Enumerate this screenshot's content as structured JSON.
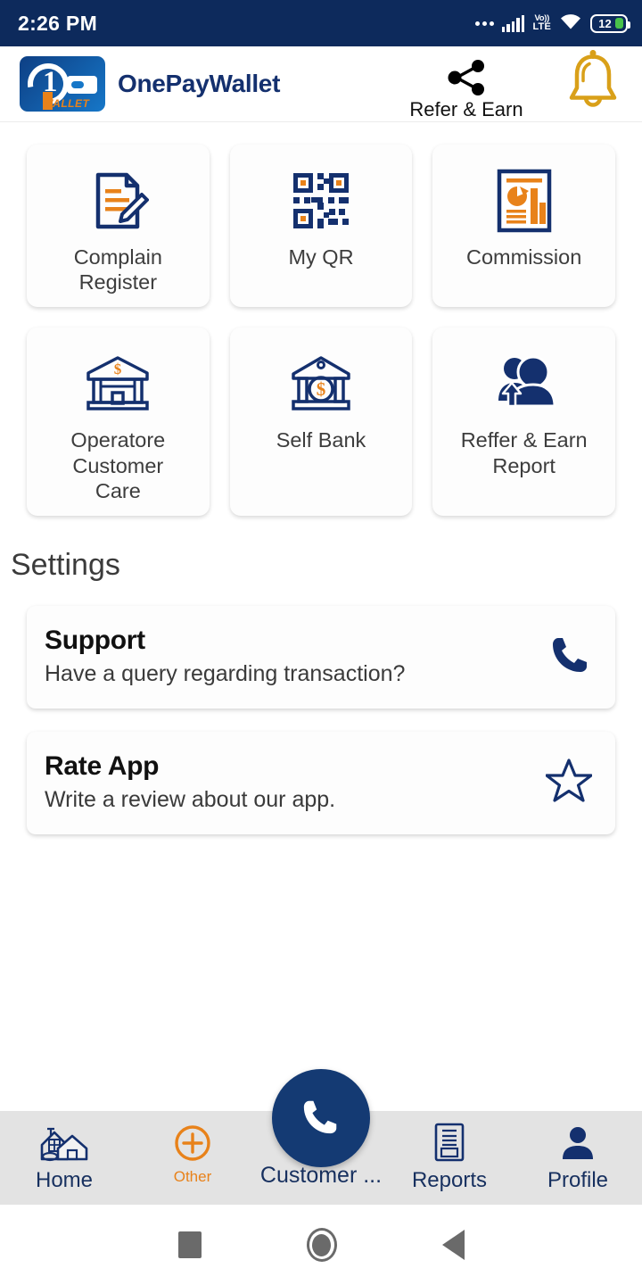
{
  "status_bar": {
    "time": "2:26 PM",
    "network_type": "VoLTE",
    "volte_top": "Vo))",
    "volte_bottom": "LTE",
    "battery_level": "12",
    "background_color": "#0d2a5c"
  },
  "app_bar": {
    "brand_name": "OnePayWallet",
    "logo_digit": "1",
    "logo_wordmark": "WALLET",
    "refer_label": "Refer & Earn",
    "share_icon": "share-icon",
    "bell_icon": "bell-icon",
    "bell_color": "#d9a019",
    "brand_color": "#14306e"
  },
  "grid": {
    "tiles": [
      {
        "label": "Complain\nRegister",
        "label_line1": "Complain",
        "label_line2": "Register",
        "icon": "document-edit-icon"
      },
      {
        "label": "My QR",
        "label_line1": "My QR",
        "label_line2": "",
        "icon": "qr-code-icon"
      },
      {
        "label": "Commission",
        "label_line1": "Commission",
        "label_line2": "",
        "icon": "report-chart-icon"
      },
      {
        "label": "Operatore Customer Care",
        "label_line1": "Operatore",
        "label_line2": "Customer",
        "label_line3": "Care",
        "icon": "bank-building-icon"
      },
      {
        "label": "Self Bank",
        "label_line1": "Self Bank",
        "label_line2": "",
        "icon": "bank-dollar-icon"
      },
      {
        "label": "Reffer & Earn Report",
        "label_line1": "Reffer & Earn",
        "label_line2": "Report",
        "icon": "people-referral-icon"
      }
    ]
  },
  "settings": {
    "heading": "Settings",
    "cards": [
      {
        "title": "Support",
        "subtitle": "Have a query regarding transaction?",
        "icon": "phone-icon"
      },
      {
        "title": "Rate App",
        "subtitle": "Write a review about our app.",
        "icon": "star-outline-icon"
      }
    ]
  },
  "bottom_nav": {
    "items": [
      {
        "label": "Home",
        "icon": "house-icon"
      },
      {
        "label": "Other",
        "icon": "plus-circle-icon"
      },
      {
        "label": "Customer ...",
        "icon": "phone-fab-icon"
      },
      {
        "label": "Reports",
        "icon": "report-document-icon"
      },
      {
        "label": "Profile",
        "icon": "person-icon"
      }
    ],
    "accent_color": "#143a73",
    "other_color": "#e8821a",
    "bar_color": "#e3e3e3"
  },
  "android_nav": {
    "recent": "recent-apps-icon",
    "home": "home-circle-icon",
    "back": "back-triangle-icon"
  },
  "theme": {
    "navy": "#14306e",
    "orange": "#e8821a",
    "page_bg": "#ffffff"
  }
}
